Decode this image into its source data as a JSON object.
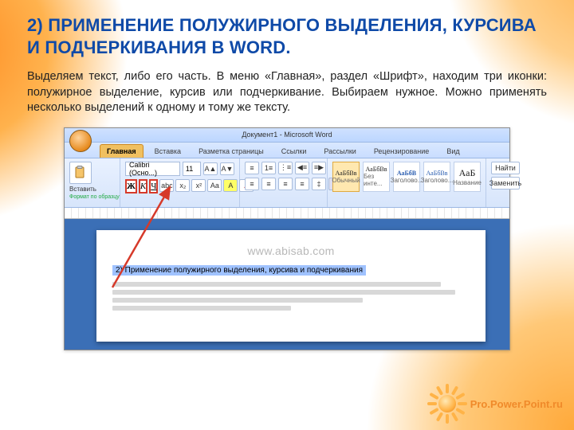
{
  "heading": "2) ПРИМЕНЕНИЕ ПОЛУЖИРНОГО ВЫДЕЛЕНИЯ, КУРСИВА И ПОДЧЕРКИВАНИЯ В WORD.",
  "paragraph": "Выделяем текст, либо его часть. В меню «Главная», раздел «Шрифт», находим три иконки: полужирное выделение, курсив или подчеркивание. Выбираем нужное. Можно применять несколько выделений к одному и тому же тексту.",
  "word": {
    "title": "Документ1 - Microsoft Word",
    "tabs": [
      "Главная",
      "Вставка",
      "Разметка страницы",
      "Ссылки",
      "Рассылки",
      "Рецензирование",
      "Вид"
    ],
    "clipboard_label": "Вставить",
    "format_painter": "Формат по образцу",
    "font_family": "Calibri (Осно...)",
    "font_size": "11",
    "biu": {
      "b": "Ж",
      "i": "К",
      "u": "Ч"
    },
    "styles": [
      "АаБбВв",
      "АаБбВв",
      "АаБбВ",
      "АаБбВв",
      "АаБ"
    ],
    "style_captions": [
      "Обычный",
      "Без инте...",
      "Заголово...",
      "Заголово...",
      "Название"
    ],
    "find_label": "Найти",
    "replace_label": "Заменить",
    "watermark": "www.abisab.com",
    "doc_heading": "2) Применение полужирного выделения, курсива и подчеркивания"
  },
  "footer_brand": "Pro.Power.Point.ru"
}
